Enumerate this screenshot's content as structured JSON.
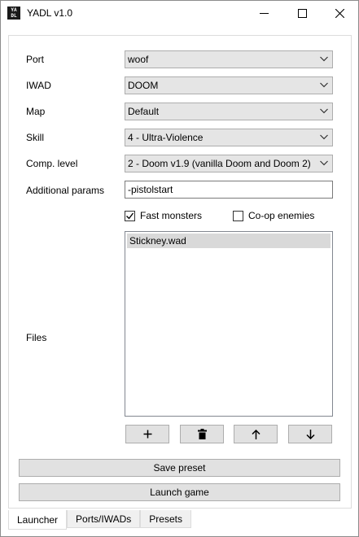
{
  "window": {
    "title": "YADL v1.0",
    "icon_text": "YA DL"
  },
  "form": {
    "port": {
      "label": "Port",
      "value": "woof"
    },
    "iwad": {
      "label": "IWAD",
      "value": "DOOM"
    },
    "map": {
      "label": "Map",
      "value": "Default"
    },
    "skill": {
      "label": "Skill",
      "value": "4 - Ultra-Violence"
    },
    "comp_level": {
      "label": "Comp. level",
      "value": "2 - Doom v1.9 (vanilla Doom and Doom 2)"
    },
    "additional_params": {
      "label": "Additional params",
      "value": "-pistolstart"
    },
    "fast_monsters": {
      "label": "Fast monsters",
      "checked": true
    },
    "coop_enemies": {
      "label": "Co-op enemies",
      "checked": false
    },
    "files": {
      "label": "Files",
      "items": [
        "Stickney.wad"
      ]
    }
  },
  "file_buttons": {
    "add_icon": "plus-icon",
    "delete_icon": "trash-icon",
    "up_icon": "arrow-up-icon",
    "down_icon": "arrow-down-icon"
  },
  "actions": {
    "save_preset": "Save preset",
    "launch_game": "Launch game"
  },
  "tabs": [
    {
      "label": "Launcher",
      "active": true
    },
    {
      "label": "Ports/IWADs",
      "active": false
    },
    {
      "label": "Presets",
      "active": false
    }
  ]
}
